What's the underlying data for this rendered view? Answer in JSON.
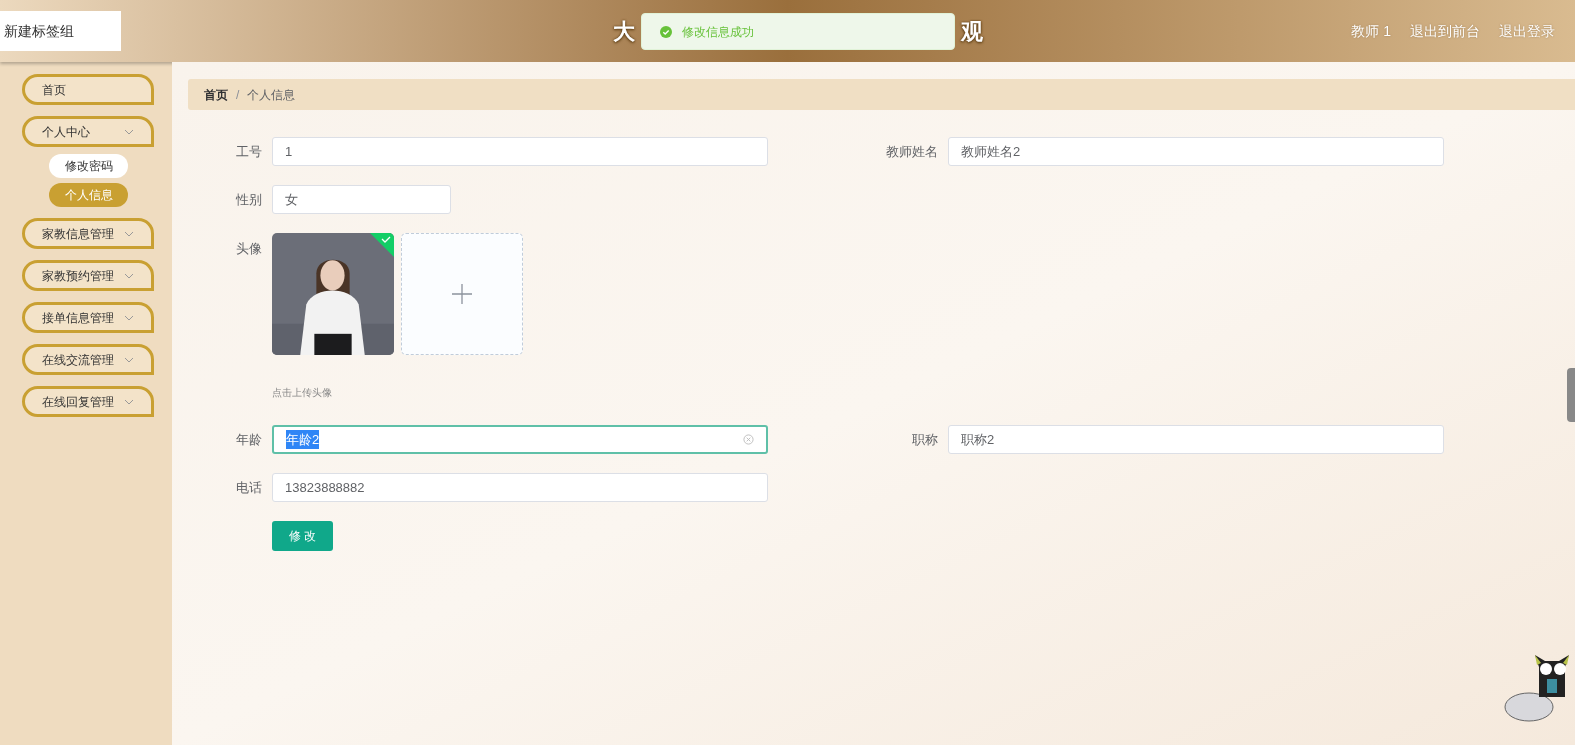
{
  "browser_tab": {
    "label": "新建标签组"
  },
  "header": {
    "title_start": "大",
    "title_end": "观",
    "user": "教师 1",
    "links": [
      "退出到前台",
      "退出登录"
    ]
  },
  "toast": {
    "text": "修改信息成功"
  },
  "sidebar": {
    "items": [
      {
        "label": "首页",
        "expandable": false
      },
      {
        "label": "个人中心",
        "expandable": true,
        "children": [
          {
            "label": "修改密码",
            "selected": false
          },
          {
            "label": "个人信息",
            "selected": true
          }
        ]
      },
      {
        "label": "家教信息管理",
        "expandable": true
      },
      {
        "label": "家教预约管理",
        "expandable": true
      },
      {
        "label": "接单信息管理",
        "expandable": true
      },
      {
        "label": "在线交流管理",
        "expandable": true
      },
      {
        "label": "在线回复管理",
        "expandable": true
      }
    ]
  },
  "breadcrumb": {
    "separator": "/",
    "items": [
      "首页",
      "个人信息"
    ]
  },
  "form": {
    "row1": [
      {
        "label": "工号",
        "value": "1"
      },
      {
        "label": "教师姓名",
        "value": "教师姓名2"
      }
    ],
    "gender": {
      "label": "性别",
      "value": "女"
    },
    "avatar": {
      "label": "头像",
      "uploaded": true,
      "hint": "点击上传头像"
    },
    "row2": [
      {
        "label": "年龄",
        "value": "年龄2",
        "focused": true
      },
      {
        "label": "职称",
        "value": "职称2",
        "focused": false
      }
    ],
    "phone": {
      "label": "电话",
      "value": "13823888882"
    },
    "submit": "修 改"
  }
}
